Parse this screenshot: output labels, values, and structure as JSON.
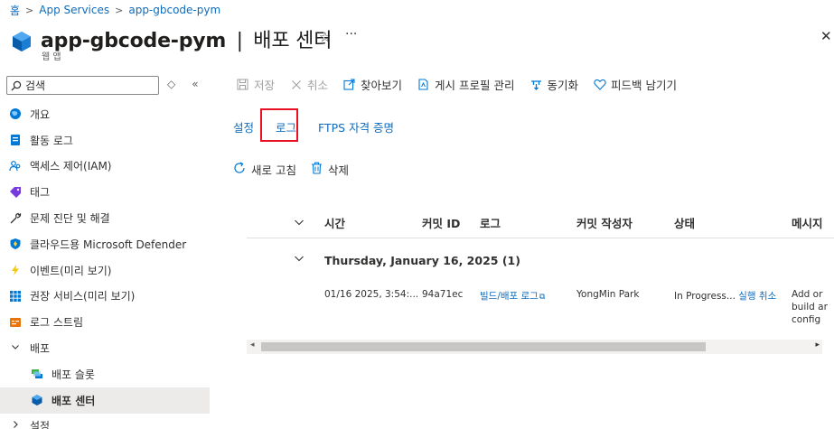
{
  "breadcrumb": {
    "home": "홈",
    "sep1": ">",
    "level1": "App Services",
    "sep2": ">",
    "level2": "app-gbcode-pym"
  },
  "header": {
    "resource_name": "app-gbcode-pym",
    "divider": "|",
    "blade": "배포 센터",
    "subtitle": "웹 앱",
    "star": "☆",
    "more": "···",
    "close": "✕"
  },
  "search": {
    "placeholder": "검색",
    "up_down": "◇",
    "collapse": "«"
  },
  "nav": {
    "items": [
      {
        "label": "개요",
        "icon": "globe-icon",
        "color": "#0078d4"
      },
      {
        "label": "활동 로그",
        "icon": "activity-log-icon",
        "color": "#0078d4"
      },
      {
        "label": "액세스 제어(IAM)",
        "icon": "people-icon",
        "color": "#0078d4"
      },
      {
        "label": "태그",
        "icon": "tag-icon",
        "color": "#773adc"
      },
      {
        "label": "문제 진단 및 해결",
        "icon": "wrench-icon",
        "color": "#323130"
      },
      {
        "label": "클라우드용 Microsoft Defender",
        "icon": "shield-icon",
        "color": "#0078d4"
      },
      {
        "label": "이벤트(미리 보기)",
        "icon": "lightning-icon",
        "color": "#f2c811"
      },
      {
        "label": "권장 서비스(미리 보기)",
        "icon": "grid-icon",
        "color": "#0078d4"
      },
      {
        "label": "로그 스트림",
        "icon": "log-stream-icon",
        "color": "#e8740c"
      },
      {
        "label": "배포",
        "icon": "chevron-down-icon",
        "expanded": true
      },
      {
        "label": "배포 슬롯",
        "icon": "deployment-slots-icon",
        "child": true
      },
      {
        "label": "배포 센터",
        "icon": "deployment-center-icon",
        "child": true,
        "active": true
      },
      {
        "label": "설정",
        "icon": "chevron-right-icon",
        "expanded": false
      }
    ]
  },
  "toolbar": {
    "save": "저장",
    "discard": "취소",
    "browse": "찾아보기",
    "manage_profile": "게시 프로필 관리",
    "sync": "동기화",
    "feedback": "피드백 남기기"
  },
  "tabs": {
    "settings": "설정",
    "logs": "로그",
    "ftps": "FTPS 자격 증명"
  },
  "actions": {
    "refresh": "새로 고침",
    "delete": "삭제"
  },
  "grid": {
    "columns": {
      "time": "시간",
      "commit_id": "커밋 ID",
      "logs": "로그",
      "author": "커밋 작성자",
      "status": "상태",
      "message": "메시지"
    },
    "group_label": "Thursday, January 16, 2025 (1)",
    "rows": [
      {
        "time": "01/16 2025, 3:54:...",
        "commit_id": "94a71ec",
        "logs": "빌드/배포 로그",
        "author": "YongMin Park",
        "status": "In Progress...",
        "cancel": "실행 취소",
        "message_l1": "Add or",
        "message_l2": "build ar",
        "message_l3": "config"
      }
    ]
  },
  "colors": {
    "accent": "#0f6cbd",
    "highlight": "#e81123",
    "selected_bg": "#edebe9"
  }
}
